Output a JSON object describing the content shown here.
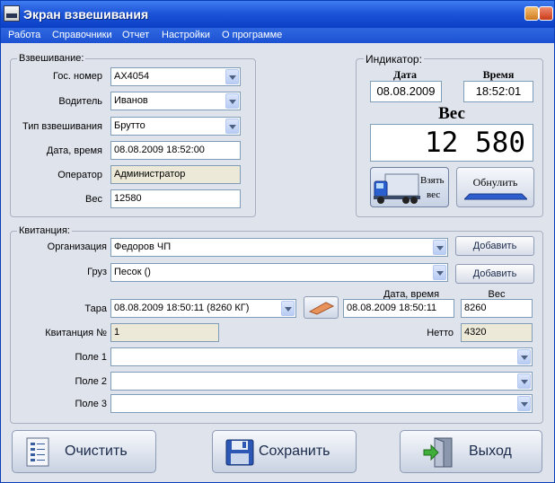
{
  "window": {
    "title": "Экран взвешивания"
  },
  "menu": [
    "Работа",
    "Справочники",
    "Отчет",
    "Настройки",
    "О программе"
  ],
  "weighing": {
    "legend": "Взвешивание:",
    "gos_nomer": {
      "label": "Гос. номер",
      "value": "АХ4054"
    },
    "driver": {
      "label": "Водитель",
      "value": "Иванов"
    },
    "type": {
      "label": "Тип взвешивания",
      "value": "Брутто"
    },
    "datetime": {
      "label": "Дата, время",
      "value": "08.08.2009 18:52:00"
    },
    "operator": {
      "label": "Оператор",
      "value": "Администратор"
    },
    "weight": {
      "label": "Вес",
      "value": "12580"
    }
  },
  "indicator": {
    "legend": "Индикатор:",
    "date_label": "Дата",
    "date_value": "08.08.2009",
    "time_label": "Время",
    "time_value": "18:52:01",
    "weight_label": "Вес",
    "weight_value": "12 580",
    "take_weight_label_1": "Взять",
    "take_weight_label_2": "вес",
    "reset_label": "Обнулить"
  },
  "receipt": {
    "legend": "Квитанция:",
    "organization": {
      "label": "Организация",
      "value": "Федоров ЧП"
    },
    "cargo": {
      "label": "Груз",
      "value": "Песок ()"
    },
    "add_label": "Добавить",
    "tare": {
      "label": "Тара",
      "value": "08.08.2009 18:50:11 (8260 КГ)"
    },
    "tare_datetime": {
      "label": "Дата, время",
      "value": "08.08.2009 18:50:11"
    },
    "tare_weight": {
      "label": "Вес",
      "value": "8260"
    },
    "receipt_no": {
      "label": "Квитанция №",
      "value": "1"
    },
    "net": {
      "label": "Нетто",
      "value": "4320"
    },
    "field1": {
      "label": "Поле 1",
      "value": ""
    },
    "field2": {
      "label": "Поле 2",
      "value": ""
    },
    "field3": {
      "label": "Поле 3",
      "value": ""
    }
  },
  "actions": {
    "clear": "Очистить",
    "save": "Сохранить",
    "exit": "Выход"
  }
}
